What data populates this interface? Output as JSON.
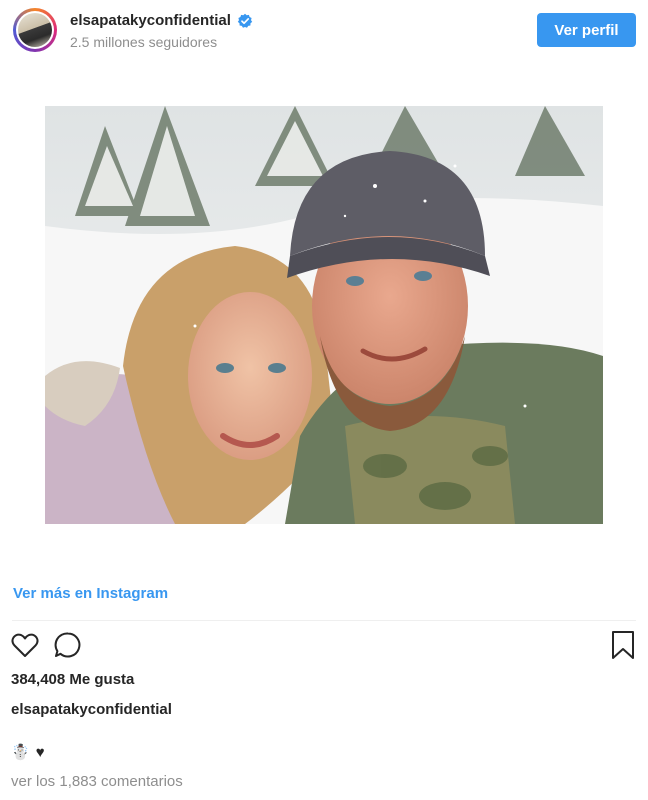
{
  "header": {
    "username": "elsapatakyconfidential",
    "followers": "2.5 millones seguidores",
    "profile_button": "Ver perfil"
  },
  "post": {
    "more_link": "Ver más en Instagram",
    "likes": "384,408 Me gusta",
    "caption_user": "elsapatakyconfidential",
    "caption_emoji": "☃️",
    "caption_heart": "♥",
    "comments_link": "ver los 1,883 comentarios"
  },
  "colors": {
    "accent": "#3897f0",
    "text": "#262626",
    "muted": "#8e8e8e"
  },
  "icons": [
    "verified-badge-icon",
    "heart-icon",
    "comment-icon",
    "bookmark-icon"
  ]
}
